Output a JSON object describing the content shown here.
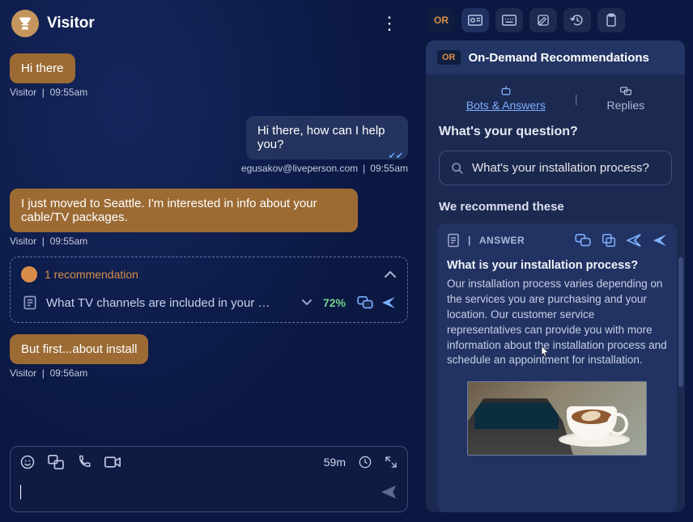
{
  "header": {
    "title": "Visitor"
  },
  "messages": {
    "m1": {
      "text": "Hi there",
      "meta_sender": "Visitor",
      "meta_time": "09:55am"
    },
    "m2": {
      "text": "Hi there, how can I help you?",
      "meta_sender": "egusakov@liveperson.com",
      "meta_time": "09:55am"
    },
    "m3": {
      "text": "I just moved to Seattle. I'm interested in info about your cable/TV packages.",
      "meta_sender": "Visitor",
      "meta_time": "09:55am"
    },
    "m4": {
      "text": "But first...about install",
      "meta_sender": "Visitor",
      "meta_time": "09:56am"
    }
  },
  "recommendation_inline": {
    "label": "1 recommendation",
    "item_title": "What TV channels are included in your …",
    "score": "72%"
  },
  "composer": {
    "timer": "59m"
  },
  "right_panel": {
    "icon_row": {
      "or_label": "OR"
    },
    "header": {
      "or_badge": "OR",
      "title": "On-Demand Recommendations"
    },
    "tabs": {
      "bots": "Bots & Answers",
      "replies": "Replies"
    },
    "question_prompt": "What's your question?",
    "search_value": "What's your installation process?",
    "rec_heading": "We recommend these",
    "answer": {
      "type_label": "ANSWER",
      "title": "What is your installation process?",
      "body": "Our installation process varies depending on the services you are purchasing and your location. Our customer service representatives can provide you with more information about the installation process and schedule an appointment for installation."
    }
  }
}
